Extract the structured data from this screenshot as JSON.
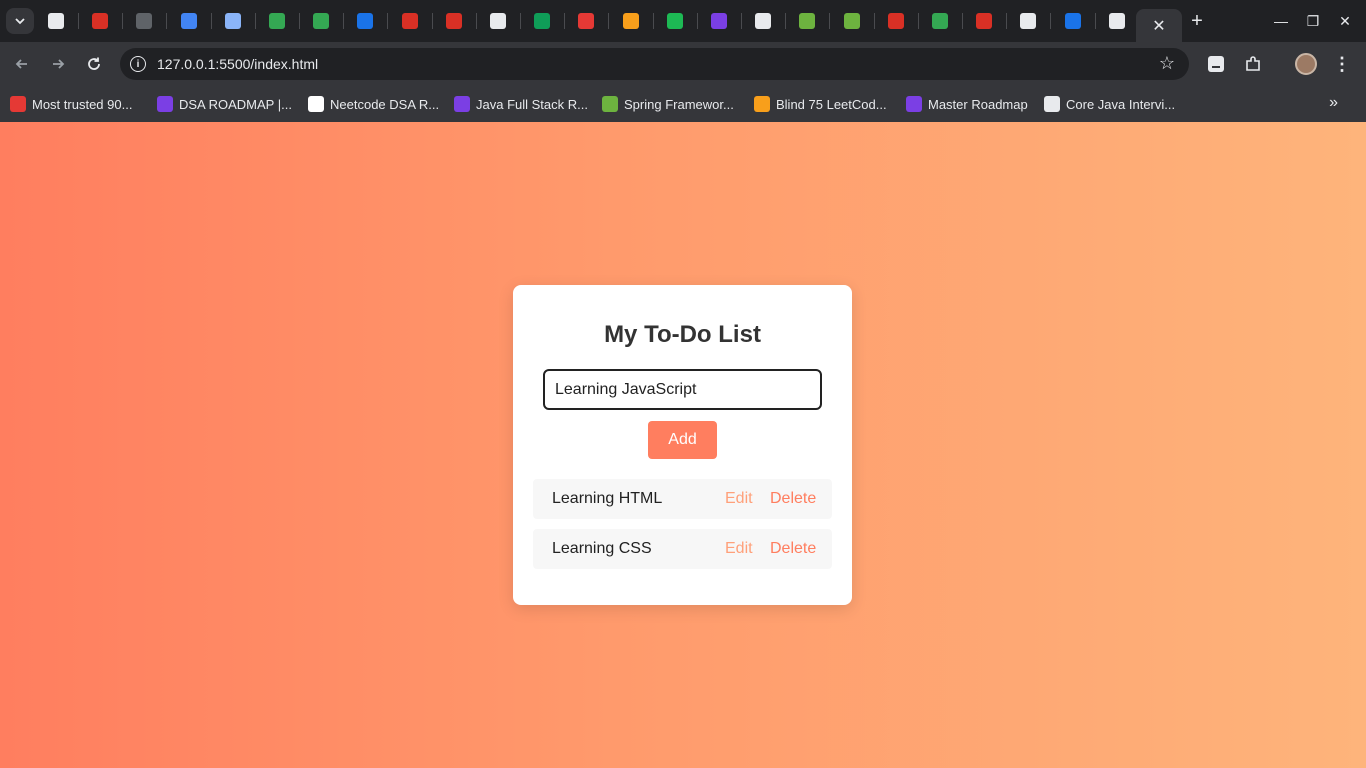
{
  "browser": {
    "url": "127.0.0.1:5500/index.html",
    "bookmarks": [
      {
        "label": "Most trusted 90...",
        "icon": "tuf-icon",
        "color": "#e53935"
      },
      {
        "label": "DSA ROADMAP |...",
        "icon": "video-icon",
        "color": "#7b3fe4"
      },
      {
        "label": "Neetcode DSA R...",
        "icon": "bell-icon",
        "color": "#ffffff"
      },
      {
        "label": "Java Full Stack R...",
        "icon": "video-icon",
        "color": "#7b3fe4"
      },
      {
        "label": "Spring Framewor...",
        "icon": "leaf-icon",
        "color": "#6db33f"
      },
      {
        "label": "Blind 75 LeetCod...",
        "icon": "leetcode-icon",
        "color": "#f89f1b"
      },
      {
        "label": "Master Roadmap",
        "icon": "video-icon",
        "color": "#7b3fe4"
      },
      {
        "label": "Core Java Intervi...",
        "icon": "mountain-icon",
        "color": "#e8eaed"
      }
    ],
    "tabs": [
      {
        "icon": "openai-icon",
        "color": "#e8eaed"
      },
      {
        "icon": "record-icon",
        "color": "#d93025"
      },
      {
        "icon": "doc-lines-icon",
        "color": "#5f6368"
      },
      {
        "icon": "docs-icon",
        "color": "#4285f4"
      },
      {
        "icon": "printer-icon",
        "color": "#8ab4f8"
      },
      {
        "icon": "chat-icon",
        "color": "#34a853"
      },
      {
        "icon": "asterisk-icon",
        "color": "#34a853"
      },
      {
        "icon": "dropbox-icon",
        "color": "#1a73e8"
      },
      {
        "icon": "youtube-icon",
        "color": "#d93025"
      },
      {
        "icon": "youtube-icon",
        "color": "#d93025"
      },
      {
        "icon": "bell-icon",
        "color": "#e8eaed"
      },
      {
        "icon": "sheets-icon",
        "color": "#0f9d58"
      },
      {
        "icon": "tuf-icon",
        "color": "#e53935"
      },
      {
        "icon": "leetcode-icon",
        "color": "#f89f1b"
      },
      {
        "icon": "spotify-icon",
        "color": "#1db954"
      },
      {
        "icon": "video-icon",
        "color": "#7b3fe4"
      },
      {
        "icon": "app-icon",
        "color": "#e8eaed"
      },
      {
        "icon": "leaf-icon",
        "color": "#6db33f"
      },
      {
        "icon": "leaf-icon",
        "color": "#6db33f"
      },
      {
        "icon": "youtube-icon",
        "color": "#d93025"
      },
      {
        "icon": "w-icon",
        "color": "#34a853"
      },
      {
        "icon": "youtube-icon",
        "color": "#d93025"
      },
      {
        "icon": "inbox-icon",
        "color": "#e8eaed"
      },
      {
        "icon": "trello-icon",
        "color": "#1a73e8"
      },
      {
        "icon": "chrome-icon",
        "color": "#e8eaed"
      }
    ]
  },
  "app": {
    "title": "My To-Do List",
    "input_value": "Learning JavaScript",
    "add_label": "Add",
    "tasks": [
      {
        "text": "Learning HTML",
        "edit": "Edit",
        "delete": "Delete"
      },
      {
        "text": "Learning CSS",
        "edit": "Edit",
        "delete": "Delete"
      }
    ]
  },
  "colors": {
    "gradient_start": "#ff7e5f",
    "gradient_end": "#feb47b",
    "accent": "#ff7e5f",
    "edit": "#ffa07a"
  }
}
